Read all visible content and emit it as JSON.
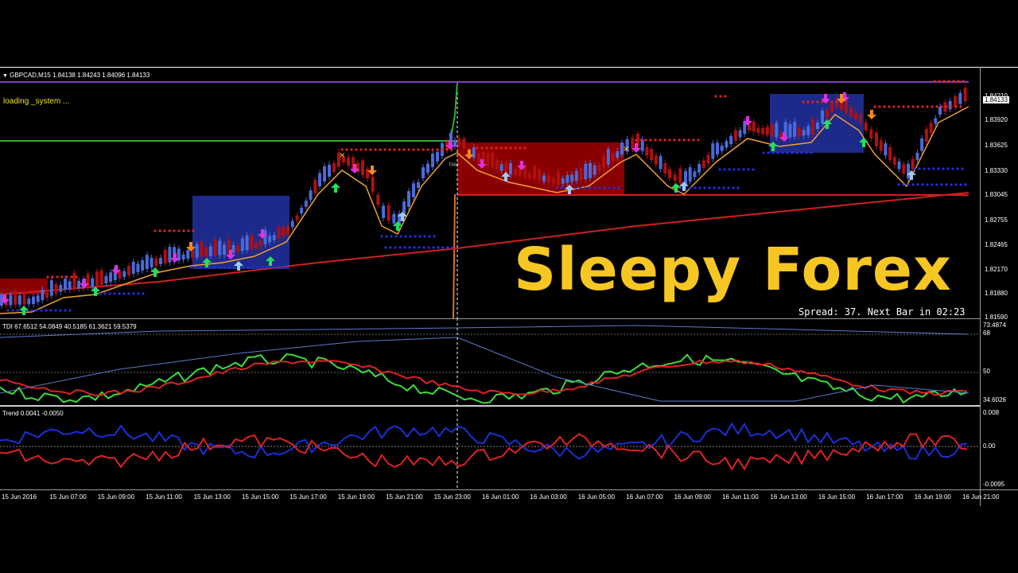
{
  "chart_window": {
    "header": "GBPCAD,M15  1.84138 1.84243 1.84096 1.84133",
    "status": "loading _system ...",
    "overlay_title": "Sleepy Forex",
    "spread_text": "Spread: 37. Next Bar in 02:23",
    "cursor_label": "тни"
  },
  "colors": {
    "bull_candle": "#4a6bd8",
    "bear_candle": "#b01010",
    "ma_line": "#f0a030",
    "trend_line": "#d02020",
    "green_line": "#2db02d",
    "tdi_green": "#3ddc3d",
    "tdi_red": "#dd2222",
    "tdi_blue": "#5a7bd0",
    "trend_blue": "#1a2fd6",
    "trend_red": "#dd2222",
    "overlay": "#f6c623"
  },
  "price_axis": {
    "ticks": [
      "1.84210",
      "1.83920",
      "1.83625",
      "1.83330",
      "1.83045",
      "1.82755",
      "1.82465",
      "1.82170",
      "1.81880",
      "1.81590"
    ],
    "current_price": "1.84133"
  },
  "tdi_panel": {
    "label": "TDI 67.6512 54.0849 40.5185 61.3621 59.5379",
    "ticks": [
      "73.4874",
      "68",
      "50",
      "34.6026"
    ]
  },
  "trend_panel": {
    "label": "Trend 0.0041 -0.0050",
    "ticks": [
      "0.008",
      "0.00",
      "-0.0095"
    ]
  },
  "time_axis": {
    "labels": [
      "15 Jun 2016",
      "15 Jun 07:00",
      "15 Jun 09:00",
      "15 Jun 11:00",
      "15 Jun 13:00",
      "15 Jun 15:00",
      "15 Jun 17:00",
      "15 Jun 19:00",
      "15 Jun 21:00",
      "15 Jun 23:00",
      "16 Jun 01:00",
      "16 Jun 03:00",
      "16 Jun 05:00",
      "16 Jun 07:00",
      "16 Jun 09:00",
      "16 Jun 11:00",
      "16 Jun 13:00",
      "16 Jun 15:00",
      "16 Jun 17:00",
      "16 Jun 19:00",
      "16 Jun 21:00"
    ]
  }
}
